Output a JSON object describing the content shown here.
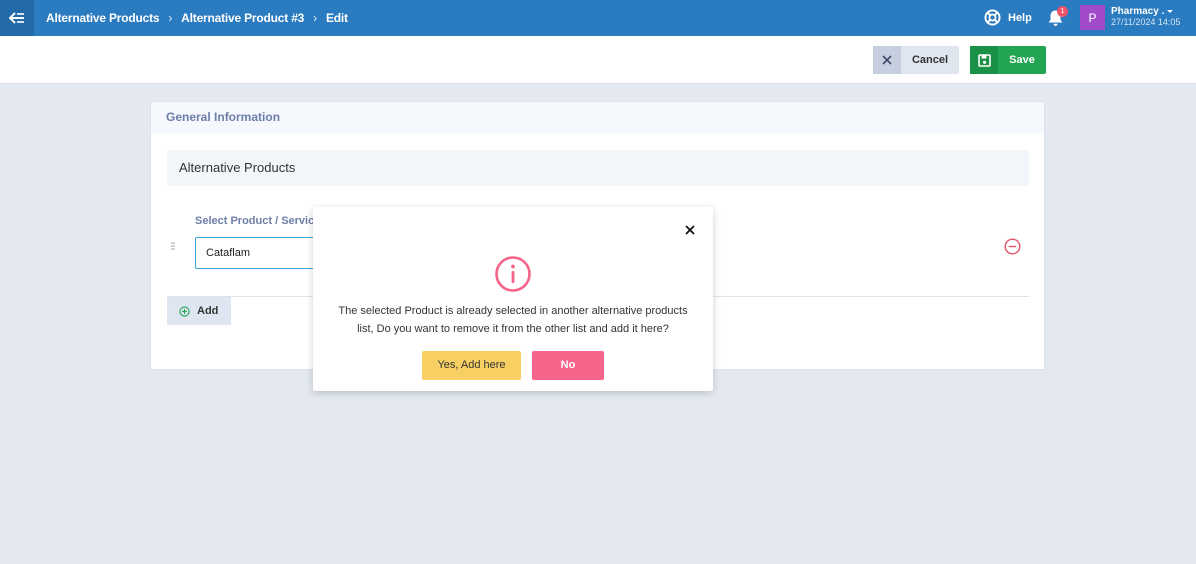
{
  "header": {
    "breadcrumbs": [
      "Alternative Products",
      "Alternative Product #3",
      "Edit"
    ],
    "help_label": "Help",
    "notification_count": "1",
    "user": {
      "avatar_letter": "P",
      "name": "Pharmacy .",
      "datetime": "27/11/2024 14:05"
    }
  },
  "toolbar": {
    "cancel_label": "Cancel",
    "save_label": "Save"
  },
  "card": {
    "title": "General Information",
    "section_title": "Alternative Products",
    "field_label": "Select Product / Service",
    "product_value": "Cataflam",
    "add_label": "Add"
  },
  "modal": {
    "message": "The selected Product is already selected in another alternative products list, Do you want to remove it from the other list and add it here?",
    "yes_label": "Yes, Add here",
    "no_label": "No"
  },
  "colors": {
    "topbar": "#2a7bbf",
    "save": "#22a553",
    "warning_icon": "#f6648a",
    "yes": "#f7cf63",
    "no": "#f6648a"
  }
}
